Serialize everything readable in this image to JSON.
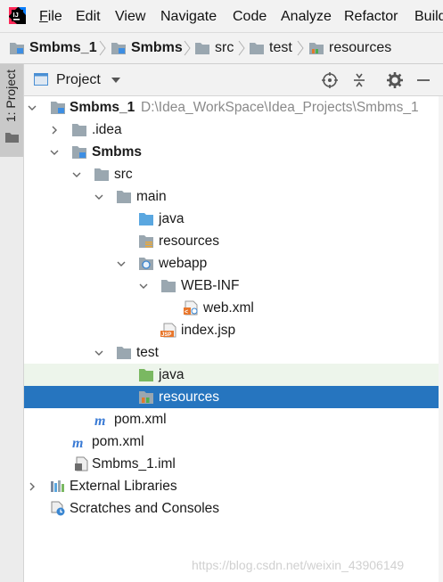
{
  "menu": {
    "items": [
      "File",
      "Edit",
      "View",
      "Navigate",
      "Code",
      "Analyze",
      "Refactor",
      "Build"
    ],
    "mnemonics": [
      "F",
      "E",
      "V",
      "N",
      "C",
      "z",
      "R",
      "u"
    ]
  },
  "breadcrumb": [
    "Smbms_1",
    "Smbms",
    "src",
    "test",
    "resources"
  ],
  "sidebar": {
    "project_tab_label": "1: Project"
  },
  "project_panel": {
    "title": "Project"
  },
  "tree": {
    "root": {
      "name": "Smbms_1",
      "path": "D:\\Idea_WorkSpace\\Idea_Projects\\Smbms_1"
    },
    "idea": ".idea",
    "module": "Smbms",
    "src": "src",
    "main": "main",
    "main_java": "java",
    "main_resources": "resources",
    "webapp": "webapp",
    "web_inf": "WEB-INF",
    "web_xml": "web.xml",
    "index_jsp": "index.jsp",
    "test": "test",
    "test_java": "java",
    "test_resources": "resources",
    "module_pom": "pom.xml",
    "root_pom": "pom.xml",
    "iml": "Smbms_1.iml",
    "external_libraries": "External Libraries",
    "scratches": "Scratches and Consoles"
  },
  "watermark": "https://blog.csdn.net/weixin_43906149",
  "colors": {
    "selection": "#2675bf",
    "hover_row": "#edf5eb",
    "source_folder": "#5aa7e0",
    "test_folder": "#7ab861",
    "maven": "#3a7bd5"
  }
}
